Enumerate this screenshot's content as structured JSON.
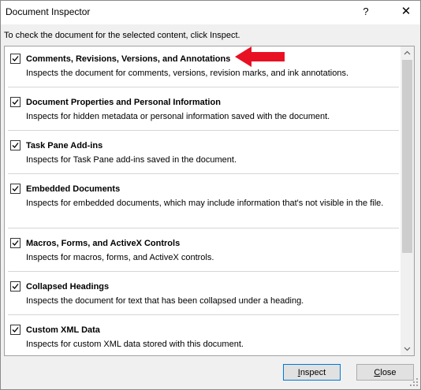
{
  "window": {
    "title": "Document Inspector",
    "help_glyph": "?",
    "close_glyph": "✕"
  },
  "instructions": "To check the document for the selected content, click Inspect.",
  "items": [
    {
      "title": "Comments, Revisions, Versions, and Annotations",
      "description": "Inspects the document for comments, versions, revision marks, and ink annotations.",
      "checked": true
    },
    {
      "title": "Document Properties and Personal Information",
      "description": "Inspects for hidden metadata or personal information saved with the document.",
      "checked": true
    },
    {
      "title": "Task Pane Add-ins",
      "description": "Inspects for Task Pane add-ins saved in the document.",
      "checked": true
    },
    {
      "title": "Embedded Documents",
      "description": "Inspects for embedded documents, which may include information that's not visible in the file.",
      "checked": true
    },
    {
      "title": "Macros, Forms, and ActiveX Controls",
      "description": "Inspects for macros, forms, and ActiveX controls.",
      "checked": true
    },
    {
      "title": "Collapsed Headings",
      "description": "Inspects the document for text that has been collapsed under a heading.",
      "checked": true
    },
    {
      "title": "Custom XML Data",
      "description": "Inspects for custom XML data stored with this document.",
      "checked": true
    }
  ],
  "buttons": {
    "inspect": {
      "mnemonic": "I",
      "rest": "nspect"
    },
    "close": {
      "mnemonic": "C",
      "rest": "lose"
    }
  },
  "annotation": {
    "arrow_color": "#e81123"
  }
}
